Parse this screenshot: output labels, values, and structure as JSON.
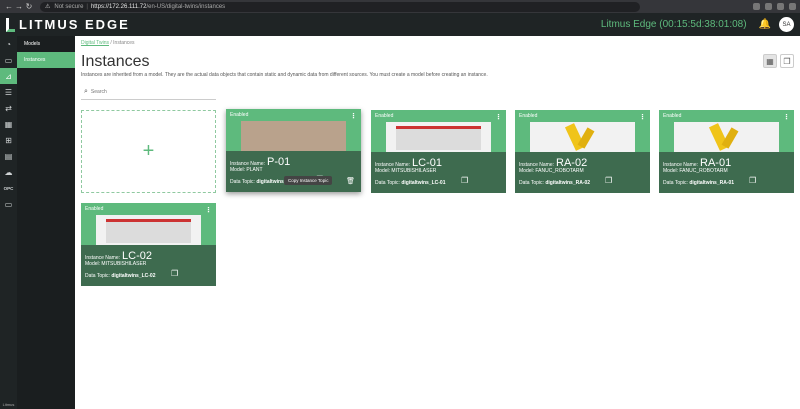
{
  "browser": {
    "security": "Not secure",
    "url_host": "https://172.26.111.72",
    "url_path": "/en-US/digital-twins/instances"
  },
  "header": {
    "logo_text": "LITMUS EDGE",
    "device": "Litmus Edge (00:15:5d:38:01:08)",
    "avatar": "SA"
  },
  "rail": {
    "opc_label": "OPC",
    "bottom_label": "Litmus"
  },
  "subnav": {
    "items": [
      {
        "label": "Models"
      },
      {
        "label": "Instances"
      }
    ]
  },
  "breadcrumb": {
    "parent": "Digital Twins",
    "separator": "/",
    "current": "Instances"
  },
  "page": {
    "title": "Instances",
    "description": "Instances are inherited from a model. They are the actual data objects that contain static and dynamic data from different sources. You must create a model before creating an instance."
  },
  "search": {
    "placeholder": "Search"
  },
  "add_card": {
    "icon": "+"
  },
  "labels": {
    "instance_name": "Instance Name:",
    "model": "Model:",
    "data_topic": "Data Topic:",
    "tooltip": "Copy Instance Topic"
  },
  "instances": [
    {
      "status": "Enabled",
      "name": "P-01",
      "model": "PLANT",
      "topic": "digitaltwins_P-01",
      "image": "plant"
    },
    {
      "status": "Enabled",
      "name": "LC-01",
      "model": "MITSUBISHILASER",
      "topic": "digitaltwins_LC-01",
      "image": "laser"
    },
    {
      "status": "Enabled",
      "name": "RA-02",
      "model": "FANUC_ROBOTARM",
      "topic": "digitaltwins_RA-02",
      "image": "robot"
    },
    {
      "status": "Enabled",
      "name": "RA-01",
      "model": "FANUC_ROBOTARM",
      "topic": "digitaltwins_RA-01",
      "image": "robot"
    },
    {
      "status": "Enabled",
      "name": "LC-02",
      "model": "MITSUBISHILASER",
      "topic": "digitaltwins_LC-02",
      "image": "laser"
    }
  ],
  "colors": {
    "accent": "#5eba7d",
    "header_bg": "#1f2425",
    "card_overlay": "#3e6b4f"
  }
}
